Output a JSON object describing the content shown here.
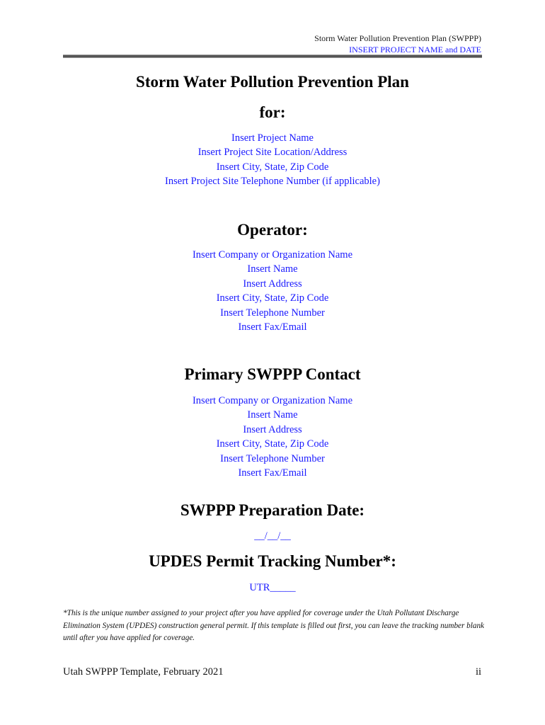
{
  "header": {
    "document_title": "Storm Water Pollution Prevention Plan (SWPPP)",
    "project_placeholder": "INSERT PROJECT NAME and DATE"
  },
  "title": {
    "line1": "Storm Water Pollution Prevention Plan",
    "line2": "for:"
  },
  "project": {
    "lines": [
      "Insert Project Name",
      "Insert Project Site Location/Address",
      "Insert City, State, Zip Code",
      "Insert Project Site Telephone Number (if applicable)"
    ]
  },
  "operator": {
    "heading": "Operator:",
    "lines": [
      "Insert Company or Organization Name",
      "Insert Name",
      "Insert Address",
      "Insert City, State, Zip Code",
      "Insert Telephone Number",
      "Insert Fax/Email"
    ]
  },
  "contact": {
    "heading": "Primary SWPPP Contact",
    "lines": [
      "Insert Company or Organization Name",
      "Insert Name",
      "Insert Address",
      "Insert City, State, Zip Code",
      "Insert Telephone Number",
      "Insert Fax/Email"
    ]
  },
  "preparation_date": {
    "heading": "SWPPP Preparation Date:",
    "value": "__/__/__"
  },
  "permit": {
    "heading": "UPDES Permit Tracking Number*:",
    "value": "UTR_____"
  },
  "footnote": "*This is the unique number assigned to your project after you have applied for coverage under the Utah Pollutant Discharge Elimination System (UPDES) construction general permit. If this template is filled out first, you can leave the tracking number blank until after you have applied for coverage.",
  "footer": {
    "left": "Utah SWPPP Template, February 2021",
    "page_number": "ii"
  },
  "colors": {
    "placeholder_blue": "#1a1aff",
    "text": "#000000",
    "rule": "#555555"
  }
}
